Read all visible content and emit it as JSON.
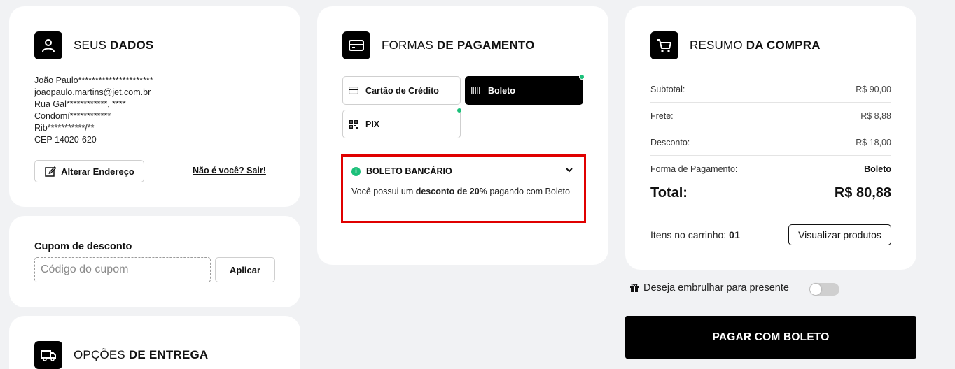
{
  "seus_dados": {
    "title_light": "SEUS",
    "title_bold": "DADOS",
    "address_lines": [
      "João Paulo**********************",
      "joaopaulo.martins@jet.com.br",
      "Rua Gal************, ****",
      "Condomí************",
      "Rib***********/**",
      "CEP 14020-620"
    ],
    "change_address_label": "Alterar Endereço",
    "logout_link": "Não é você? Sair!"
  },
  "cupom": {
    "label": "Cupom de desconto",
    "placeholder": "Código do cupom",
    "apply_label": "Aplicar"
  },
  "entrega": {
    "title_light": "OPÇÕES",
    "title_bold": "DE ENTREGA"
  },
  "pagamento": {
    "title_light": "FORMAS",
    "title_bold": "DE PAGAMENTO",
    "options": [
      {
        "label": "Cartão de Crédito",
        "active": false
      },
      {
        "label": "Boleto",
        "active": true
      },
      {
        "label": "PIX",
        "active": false
      }
    ],
    "boleto_box": {
      "title": "BOLETO BANCÁRIO",
      "text_before": "Você possui um ",
      "text_bold": "desconto de 20%",
      "text_after": " pagando com Boleto"
    }
  },
  "resumo": {
    "title_light": "RESUMO",
    "title_bold": "DA COMPRA",
    "rows": [
      {
        "label": "Subtotal:",
        "value": "R$ 90,00"
      },
      {
        "label": "Frete:",
        "value": "R$ 8,88"
      },
      {
        "label": "Desconto:",
        "value": "R$ 18,00"
      },
      {
        "label": "Forma de Pagamento:",
        "value": "Boleto"
      }
    ],
    "total_label": "Total:",
    "total_value": "R$ 80,88",
    "items_label": "Itens no carrinho:",
    "items_count": "01",
    "view_products_label": "Visualizar produtos"
  },
  "gift": {
    "label": "Deseja embrulhar para presente",
    "enabled": false
  },
  "pay_button_label": "PAGAR COM BOLETO",
  "colors": {
    "accent_green": "#1cc07a",
    "highlight_red": "#e00000",
    "background": "#f1f2f4"
  }
}
